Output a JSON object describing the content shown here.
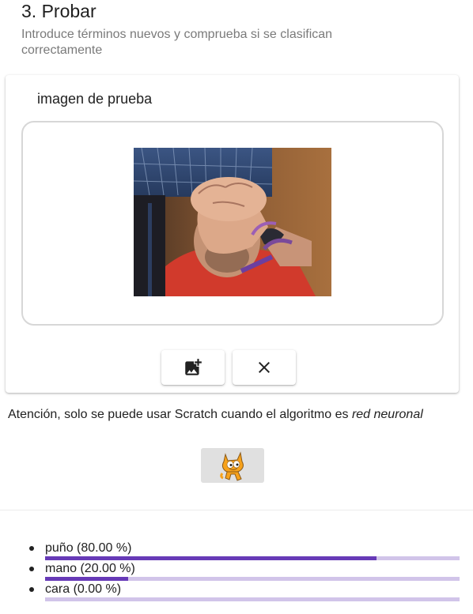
{
  "section": {
    "title": "3. Probar",
    "subtitle": "Introduce términos nuevos y comprueba si se clasifican correctamente"
  },
  "card": {
    "title": "imagen de prueba",
    "image_icon": "add-photo-icon",
    "clear_icon": "close-icon"
  },
  "notice": {
    "text": "Atención, solo se puede usar Scratch cuando el algoritmo es",
    "emphasis": "red neuronal"
  },
  "scratch": {
    "icon": "scratch-cat-icon"
  },
  "colors": {
    "accent": "#673ab7",
    "track": "#d1c4e9"
  },
  "results": [
    {
      "label": "puño (80.00 %)",
      "value": 0.8
    },
    {
      "label": "mano (20.00 %)",
      "value": 0.2
    },
    {
      "label": "cara (0.00 %)",
      "value": 0.0
    }
  ]
}
